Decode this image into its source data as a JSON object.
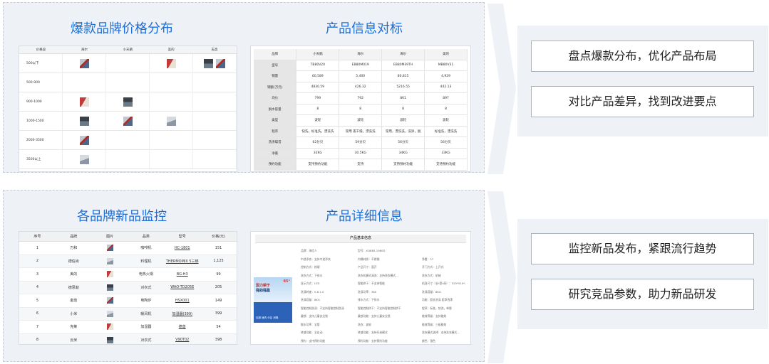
{
  "panel_top": {
    "left_title": "爆款品牌价格分布",
    "right_title": "产品信息对标",
    "price_table": {
      "headers": [
        "价格段",
        "海尔",
        "小天鹅",
        "美的",
        "志高"
      ],
      "rows": [
        {
          "label": "500以下",
          "cells": [
            1,
            0,
            1,
            2
          ]
        },
        {
          "label": "500-900",
          "cells": [
            0,
            0,
            0,
            0
          ]
        },
        {
          "label": "900-1000",
          "cells": [
            1,
            1,
            0,
            0
          ]
        },
        {
          "label": "1000-1500",
          "cells": [
            1,
            1,
            1,
            0
          ]
        },
        {
          "label": "2000-3500",
          "cells": [
            1,
            0,
            0,
            0
          ]
        },
        {
          "label": "3500以上",
          "cells": [
            1,
            0,
            0,
            0
          ]
        }
      ]
    },
    "compare_table": {
      "rows": [
        [
          "品牌",
          "小天鹅",
          "海尔",
          "海尔",
          "美的"
        ],
        [
          "型号",
          "TB80V20",
          "EB80M019",
          "EB80M39TH",
          "MB80V31"
        ],
        [
          "销量",
          "60,589",
          "5,400",
          "80,815",
          "4,929"
        ],
        [
          "销额(万元)",
          "4830.59",
          "426.32",
          "5216.55",
          "442.13"
        ],
        [
          "均价",
          "799",
          "792",
          "861",
          "897"
        ],
        [
          "脱水容量",
          "8",
          "8",
          "8",
          "8"
        ],
        [
          "类型",
          "波轮",
          "波轮",
          "波轮",
          "波轮"
        ],
        [
          "程序",
          "快洗，标准洗，漂洗洗",
          "常用 夜干燥，漂洗洗",
          "常用，漂洗洗，洗涤，脱",
          "标准洗，漂洗洗"
        ],
        [
          "洗涤噪音",
          "62分贝",
          "59分贝",
          "56分贝",
          "56分贝"
        ],
        [
          "净重",
          "33KG",
          "30.5KG",
          "34KG",
          "33KG"
        ],
        [
          "预约功能",
          "支持预约功能",
          "支持",
          "支持预约功能",
          "支持预约功能"
        ]
      ]
    }
  },
  "panel_bottom": {
    "left_title": "各品牌新品监控",
    "right_title": "产品详细信息",
    "new_table": {
      "headers": [
        "序号",
        "品牌",
        "图片",
        "品类",
        "型号",
        "价格(元)"
      ],
      "rows": [
        [
          "1",
          "万和",
          "",
          "咖啡机",
          "HC-1801",
          "151"
        ],
        [
          "2",
          "德信尚",
          "",
          "料理机",
          "THERMOMIX 5三绑",
          "1,125"
        ],
        [
          "3",
          "美的",
          "",
          "电热火锅",
          "BG-H3",
          "99"
        ],
        [
          "4",
          "德思勒",
          "",
          "对衣式",
          "WAO-TD205E",
          "205"
        ],
        [
          "5",
          "金鼎",
          "",
          "电陶炉",
          "HSX001",
          "149"
        ],
        [
          "6",
          "小米",
          "",
          "暖风机",
          "加湿器(399)",
          "399"
        ],
        [
          "7",
          "克莱",
          "",
          "加湿器",
          "德善",
          "54"
        ],
        [
          "8",
          "云米",
          "",
          "对衣式",
          "V90T02",
          "398"
        ]
      ]
    },
    "detail": {
      "title": "产品基本信息",
      "promo_line1": "国力荣于",
      "promo_line2": "强劲强盈",
      "promo_badge": "85°",
      "promo_footer": "至超 速洗 分区 消毒",
      "specs": [
        [
          "品牌：海信人",
          "型号：XQB85-1980D",
          ""
        ],
        [
          "中途添衣：支持中途添衣",
          "内桶材质：不锈钢",
          "净重：27"
        ],
        [
          "控制方式：按键",
          "产品尺寸：面开",
          "开门方式：上开式"
        ],
        [
          "洗衣方式：下排水",
          "洗衣机模式清洗：支持洗衣模式…",
          "洗衣方式：机械"
        ],
        [
          "显示方式：LED",
          "智能烘干：不支持智能",
          "机身尺寸（长*宽*高）：525*510*…"
        ],
        [
          "洗涤转速：0.8-1.0",
          "洗涤功率：380",
          "洗涤容量：8KG"
        ],
        [
          "洗涤容量：8KG",
          "排水方式：下排水",
          "功能：超长洗涤 超净泡漂"
        ],
        [
          "智能控制洗涤：不支持智能控制洗涤",
          "智能控制烘干：不支持智能控制烘干",
          "程序：标准，快洗，单脱"
        ],
        [
          "童锁：支持儿童安全锁",
          "童锁功能：支持儿童安全锁",
          "能效等级：支持能效"
        ],
        [
          "脱水功率：全管",
          "洗衣：波轮",
          "能效等级：三级能效"
        ],
        [
          "转速功能：全自动",
          "转速功能：支持开启模式",
          "洗衣模式选择：支持洗衣模式…"
        ],
        [
          "预约：支持预约功能",
          "预约功能：支持预约功能",
          "颜色：银色"
        ]
      ]
    }
  },
  "right_top": {
    "item1": "盘点爆款分布，优化产品布局",
    "item2": "对比产品差异，找到改进要点"
  },
  "right_bottom": {
    "item1": "监控新品发布，紧跟流行趋势",
    "item2": "研究竞品参数，助力新品研发"
  }
}
